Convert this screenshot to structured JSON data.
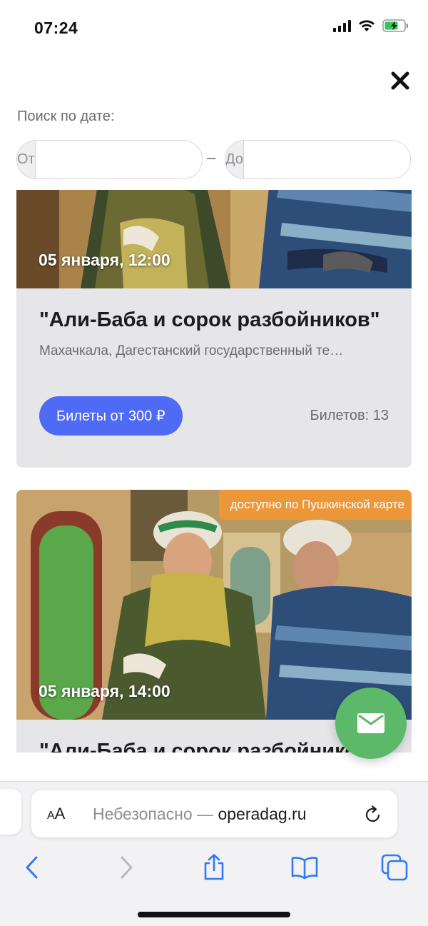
{
  "status_bar": {
    "time": "07:24"
  },
  "search": {
    "label": "Поиск по дате:",
    "from_prefix": "От",
    "to_prefix": "До",
    "separator": "–",
    "from_value": "",
    "to_value": ""
  },
  "events": [
    {
      "date": "05 января, 12:00",
      "title": "\"Али-Баба и сорок разбойников\"",
      "venue": "Махачкала, Дагестанский государственный те…",
      "ticket_label": "Билеты от 300 ₽",
      "tickets_left": "Билетов: 13"
    },
    {
      "badge": "доступно по Пушкинской карте",
      "date": "05 января, 14:00",
      "title": "\"Али-Баба и сорок разбойников\""
    }
  ],
  "browser": {
    "aa_small": "A",
    "aa_large": "A",
    "url_prefix": "Небезопасно — ",
    "url_domain": "operadag.ru"
  },
  "colors": {
    "accent": "#4f6bf5",
    "fab": "#5cb96a",
    "badge": "#f59632",
    "card_bg": "#e6e6e9"
  },
  "icons": [
    "close-icon",
    "mail-icon",
    "reload-icon",
    "back-icon",
    "forward-icon",
    "share-icon",
    "bookmarks-icon",
    "tabs-icon",
    "signal-icon",
    "wifi-icon",
    "battery-icon"
  ]
}
